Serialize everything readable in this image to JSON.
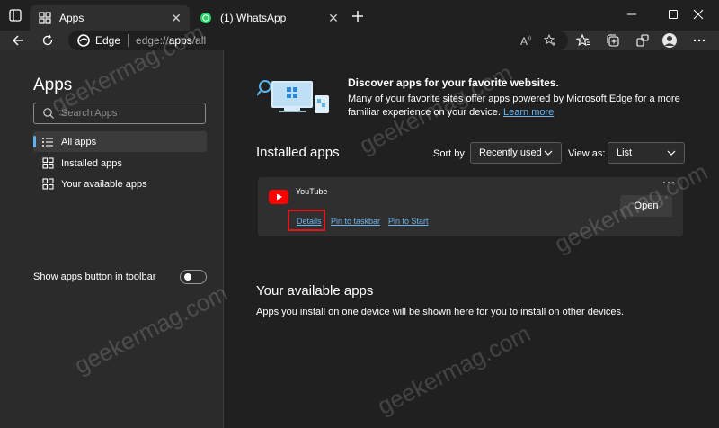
{
  "window": {
    "tabs": [
      {
        "title": "Apps",
        "active": true
      },
      {
        "title": "(1) WhatsApp",
        "active": false
      }
    ]
  },
  "address_bar": {
    "site_label": "Edge",
    "url_scheme": "edge://",
    "url_path": "apps",
    "url_rest": "/all"
  },
  "sidebar": {
    "title": "Apps",
    "search_placeholder": "Search Apps",
    "items": [
      {
        "label": "All apps",
        "icon": "list-icon",
        "selected": true
      },
      {
        "label": "Installed apps",
        "icon": "apps-grid-icon",
        "selected": false
      },
      {
        "label": "Your available apps",
        "icon": "apps-grid-icon",
        "selected": false
      }
    ],
    "toolbar_toggle_label": "Show apps button in toolbar",
    "toolbar_toggle_on": false
  },
  "discover": {
    "title": "Discover apps for your favorite websites.",
    "text": "Many of your favorite sites offer apps powered by Microsoft Edge for a more familiar experience on your device. ",
    "link": "Learn more"
  },
  "installed": {
    "title": "Installed apps",
    "sort_label": "Sort by:",
    "sort_value": "Recently used",
    "view_label": "View as:",
    "view_value": "List",
    "apps": [
      {
        "name": "YouTube",
        "open_label": "Open",
        "links": [
          "Details",
          "Pin to taskbar",
          "Pin to Start"
        ]
      }
    ]
  },
  "available": {
    "title": "Your available apps",
    "text": "Apps you install on one device will be shown here for you to install on other devices."
  },
  "watermark": "geekermag.com",
  "colors": {
    "accent_link": "#6cb4f0",
    "highlight": "#e0161d",
    "youtube_red": "#ff0000",
    "whatsapp_green": "#25d366"
  }
}
